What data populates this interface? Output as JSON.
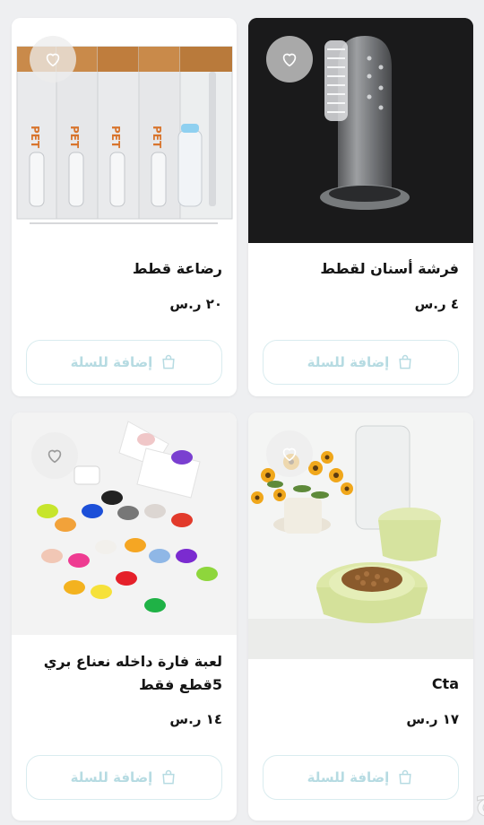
{
  "products": [
    {
      "title": "فرشة أسنان لقطط",
      "price": "٤ ر.س",
      "cart_label": "إضافة للسلة",
      "image": "silicone-finger-toothbrush"
    },
    {
      "title": "رضاعة قطط",
      "price": "٢٠ ر.س",
      "cart_label": "إضافة للسلة",
      "image": "pet-nursing-bottle-kits",
      "image_text": "PET"
    },
    {
      "title": "Cta",
      "price": "١٧ ر.س",
      "cart_label": "إضافة للسلة",
      "image": "green-food-bowl-water-dispenser"
    },
    {
      "title": "لعبة فارة داخله نعناع بري 5قطع فقط",
      "price": "١٤ ر.س",
      "cart_label": "إضافة للسلة",
      "image": "colorful-toy-mice"
    }
  ],
  "watermark": "حراج",
  "icons": {
    "favorite": "heart-icon",
    "cart": "shopping-bag-icon"
  },
  "colors": {
    "button_border": "#d9ecef",
    "button_text": "#b6dbe2",
    "card_bg": "#ffffff",
    "page_bg": "#eeeff1"
  }
}
